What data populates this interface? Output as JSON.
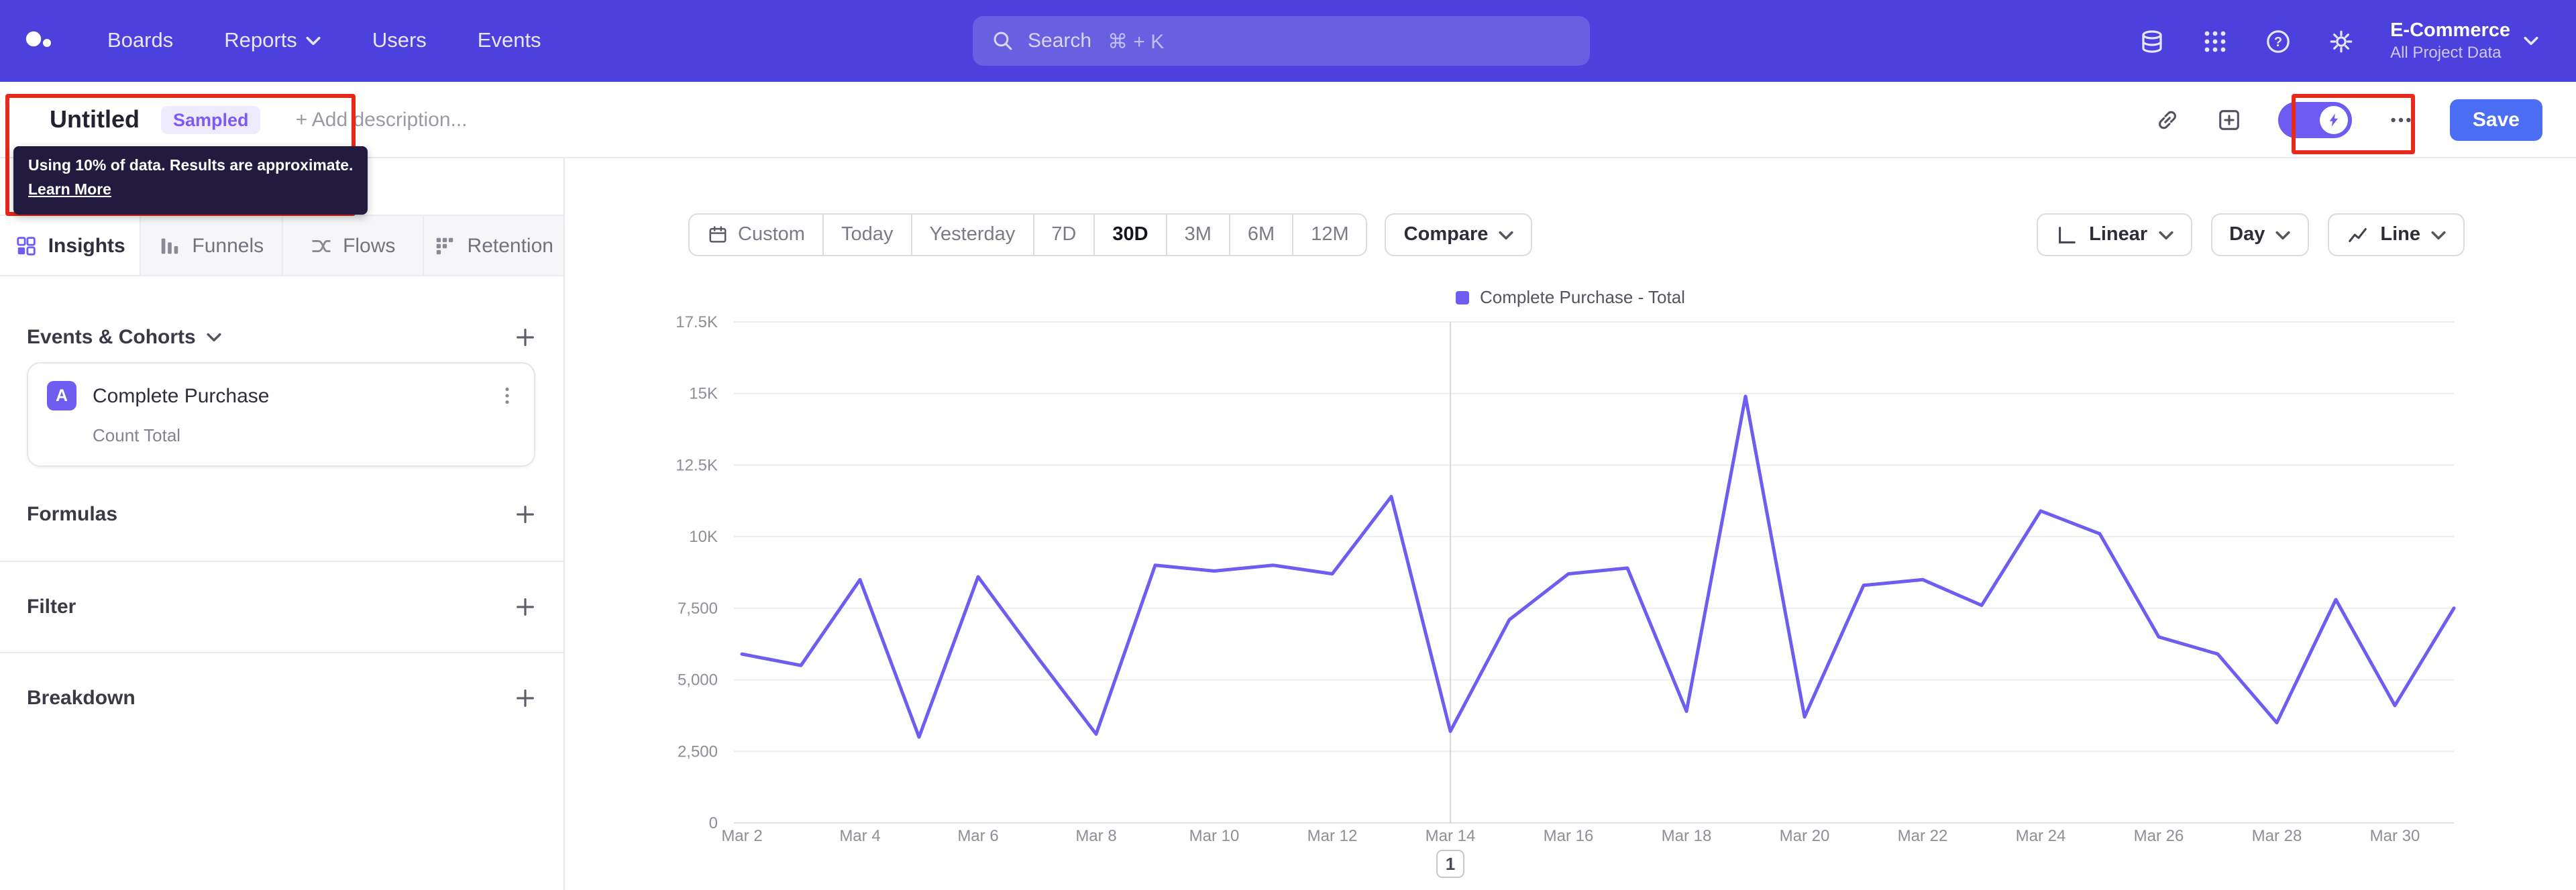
{
  "topnav": {
    "nav_items": [
      {
        "label": "Boards"
      },
      {
        "label": "Reports"
      },
      {
        "label": "Users"
      },
      {
        "label": "Events"
      }
    ],
    "search": {
      "label": "Search",
      "shortcut": "⌘ + K"
    },
    "project": {
      "name": "E-Commerce",
      "scope": "All Project Data"
    }
  },
  "report_header": {
    "title": "Untitled",
    "sampled_badge": "Sampled",
    "add_description": "+ Add description...",
    "save_label": "Save"
  },
  "sampling_tooltip": {
    "message": "Using 10% of data. Results are approximate.",
    "link_label": "Learn More"
  },
  "sidebar": {
    "tabs": [
      {
        "label": "Insights",
        "active": true
      },
      {
        "label": "Funnels",
        "active": false
      },
      {
        "label": "Flows",
        "active": false
      },
      {
        "label": "Retention",
        "active": false
      }
    ],
    "events_section_label": "Events & Cohorts",
    "event_card": {
      "badge": "A",
      "name": "Complete Purchase",
      "metric": "Count Total"
    },
    "sections": [
      {
        "label": "Formulas"
      },
      {
        "label": "Filter"
      },
      {
        "label": "Breakdown"
      }
    ]
  },
  "controls": {
    "date_ranges": [
      "Custom",
      "Today",
      "Yesterday",
      "7D",
      "30D",
      "3M",
      "6M",
      "12M"
    ],
    "active_range": "30D",
    "compare_label": "Compare",
    "view_buttons": [
      {
        "label": "Linear"
      },
      {
        "label": "Day"
      },
      {
        "label": "Line"
      }
    ]
  },
  "chart_data": {
    "type": "line",
    "title": "",
    "grid": true,
    "legend_position": "top-center",
    "x": [
      "Mar 2",
      "Mar 3",
      "Mar 4",
      "Mar 5",
      "Mar 6",
      "Mar 7",
      "Mar 8",
      "Mar 9",
      "Mar 10",
      "Mar 11",
      "Mar 12",
      "Mar 13",
      "Mar 14",
      "Mar 15",
      "Mar 16",
      "Mar 17",
      "Mar 18",
      "Mar 19",
      "Mar 20",
      "Mar 21",
      "Mar 22",
      "Mar 23",
      "Mar 24",
      "Mar 25",
      "Mar 26",
      "Mar 27",
      "Mar 28",
      "Mar 29",
      "Mar 30",
      "Mar 31"
    ],
    "series": [
      {
        "name": "Complete Purchase - Total",
        "color": "#6F5CF1",
        "values": [
          5900,
          5500,
          8500,
          3000,
          8600,
          5800,
          3100,
          9000,
          8800,
          9000,
          8700,
          11400,
          3200,
          7100,
          8700,
          8900,
          3900,
          14900,
          3700,
          8300,
          8500,
          7600,
          10900,
          10100,
          6500,
          5900,
          3500,
          7800,
          4100,
          7500
        ]
      }
    ],
    "ylim": [
      0,
      17500
    ],
    "y_tick_labels": [
      "17.5K",
      "15K",
      "12.5K",
      "10K",
      "7,500",
      "5,000",
      "2,500",
      "0"
    ],
    "x_tick_labels": [
      "Mar 2",
      "Mar 4",
      "Mar 6",
      "Mar 8",
      "Mar 10",
      "Mar 12",
      "Mar 14",
      "Mar 16",
      "Mar 18",
      "Mar 20",
      "Mar 22",
      "Mar 24",
      "Mar 26",
      "Mar 28",
      "Mar 30"
    ],
    "annotations": [
      {
        "label": "1",
        "x": "Mar 14",
        "x_index": 12
      }
    ]
  },
  "colors": {
    "topnav_purple": "#4C41DC",
    "accent_purple": "#6F5CF1",
    "save_blue": "#4C6EF5",
    "annotation_red": "#E7281B",
    "sampled_badge_bg": "#EFEBFE"
  }
}
